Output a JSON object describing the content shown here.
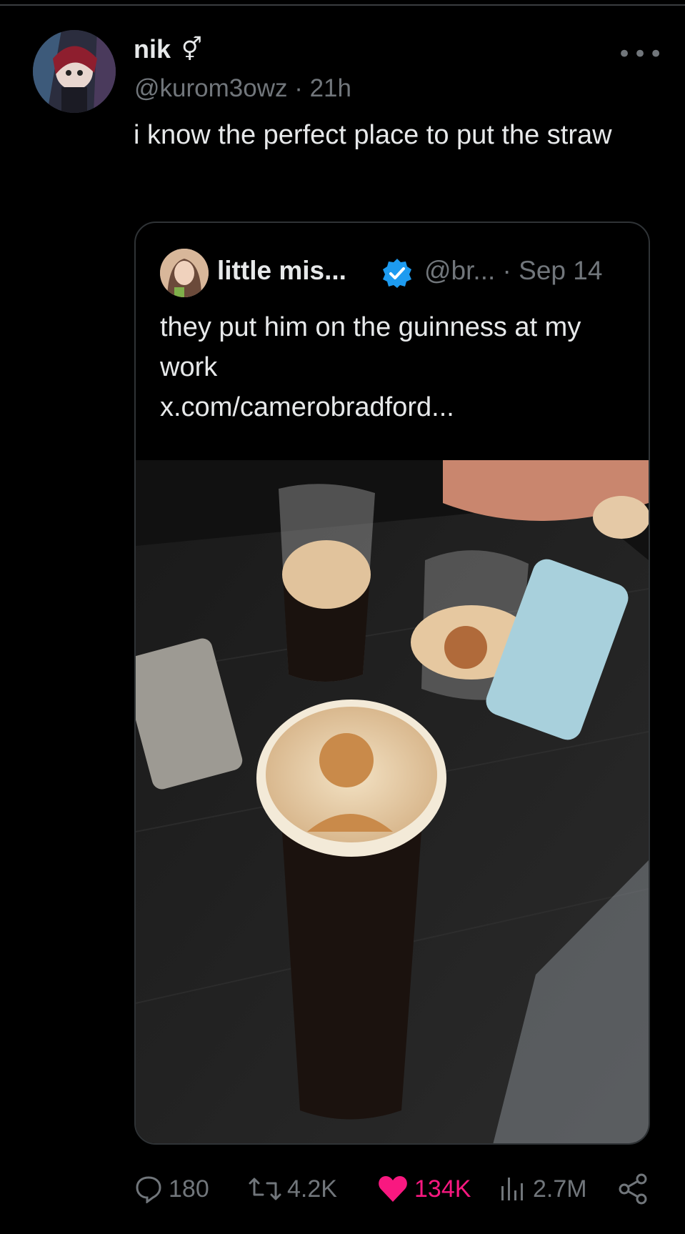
{
  "tweet": {
    "display_name": "nik",
    "name_emoji": "⚥",
    "handle_time": "@kurom3owz · 21h",
    "more_label": "•••",
    "text": "i know the perfect place to put the straw"
  },
  "quoted": {
    "display_name": "little mis...",
    "handle_date": "@br... · Sep 14",
    "text": "they put him on the guinness at my work",
    "link": "x.com/camerobradford..."
  },
  "actions": {
    "replies": "180",
    "reposts": "4.2K",
    "likes": "134K",
    "views": "2.7M"
  },
  "colors": {
    "background": "#000000",
    "text": "#e7e9ea",
    "muted": "#71767b",
    "like": "#f91880",
    "verified": "#1d9bf0"
  }
}
